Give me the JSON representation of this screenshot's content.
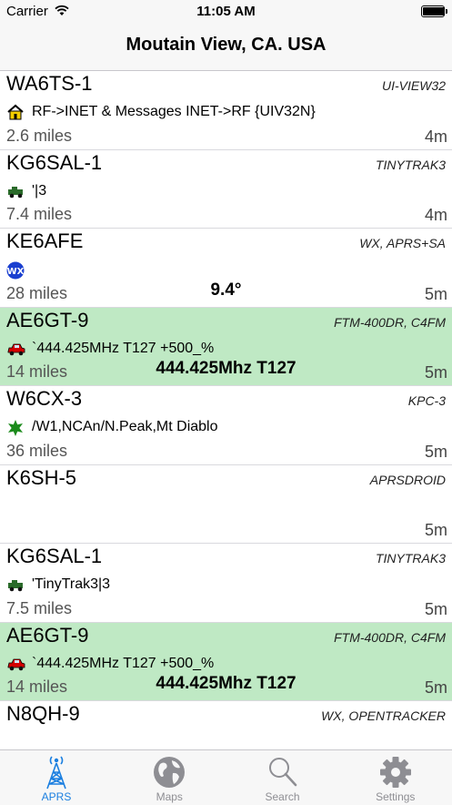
{
  "status": {
    "carrier": "Carrier",
    "time": "11:05 AM",
    "battery_level": 1.0
  },
  "nav": {
    "title": "Moutain View, CA. USA"
  },
  "stations": [
    {
      "callsign": "WA6TS-1",
      "device": "UI-VIEW32",
      "icon": "house-icon",
      "comment": "RF->INET & Messages INET->RF {UIV32N}",
      "distance": "2.6 miles",
      "info": "",
      "age": "4m",
      "highlight": false
    },
    {
      "callsign": "KG6SAL-1",
      "device": "TINYTRAK3",
      "icon": "jeep-icon",
      "comment": "'|3",
      "distance": "7.4 miles",
      "info": "",
      "age": "4m",
      "highlight": false
    },
    {
      "callsign": "KE6AFE",
      "device": "WX, APRS+SA",
      "icon": "wx-icon",
      "comment": "",
      "distance": "28 miles",
      "info": "9.4°",
      "age": "5m",
      "highlight": false
    },
    {
      "callsign": "AE6GT-9",
      "device": "FTM-400DR, C4FM",
      "icon": "car-icon",
      "comment": "`444.425MHz T127 +500_%",
      "distance": "14 miles",
      "info": "444.425Mhz T127",
      "age": "5m",
      "highlight": true
    },
    {
      "callsign": "W6CX-3",
      "device": "KPC-3",
      "icon": "star-icon",
      "comment": "/W1,NCAn/N.Peak,Mt Diablo",
      "distance": "36 miles",
      "info": "",
      "age": "5m",
      "highlight": false
    },
    {
      "callsign": "K6SH-5",
      "device": "APRSDROID",
      "icon": "",
      "comment": "",
      "distance": "",
      "info": "",
      "age": "5m",
      "highlight": false
    },
    {
      "callsign": "KG6SAL-1",
      "device": "TINYTRAK3",
      "icon": "jeep-icon",
      "comment": "'TinyTrak3|3",
      "distance": "7.5 miles",
      "info": "",
      "age": "5m",
      "highlight": false
    },
    {
      "callsign": "AE6GT-9",
      "device": "FTM-400DR, C4FM",
      "icon": "car-icon",
      "comment": "`444.425MHz T127 +500_%",
      "distance": "14 miles",
      "info": "444.425Mhz T127",
      "age": "5m",
      "highlight": true
    },
    {
      "callsign": "N8QH-9",
      "device": "WX, OPENTRACKER",
      "icon": "",
      "comment": "",
      "distance": "",
      "info": "",
      "age": "",
      "highlight": false
    }
  ],
  "tabs": [
    {
      "label": "APRS",
      "icon": "antenna-icon",
      "active": true
    },
    {
      "label": "Maps",
      "icon": "globe-icon",
      "active": false
    },
    {
      "label": "Search",
      "icon": "search-icon",
      "active": false
    },
    {
      "label": "Settings",
      "icon": "gear-icon",
      "active": false
    }
  ],
  "colors": {
    "accent": "#1b7fe0",
    "highlight_row": "#bfe9c4",
    "tab_inactive": "#8e8e93"
  }
}
